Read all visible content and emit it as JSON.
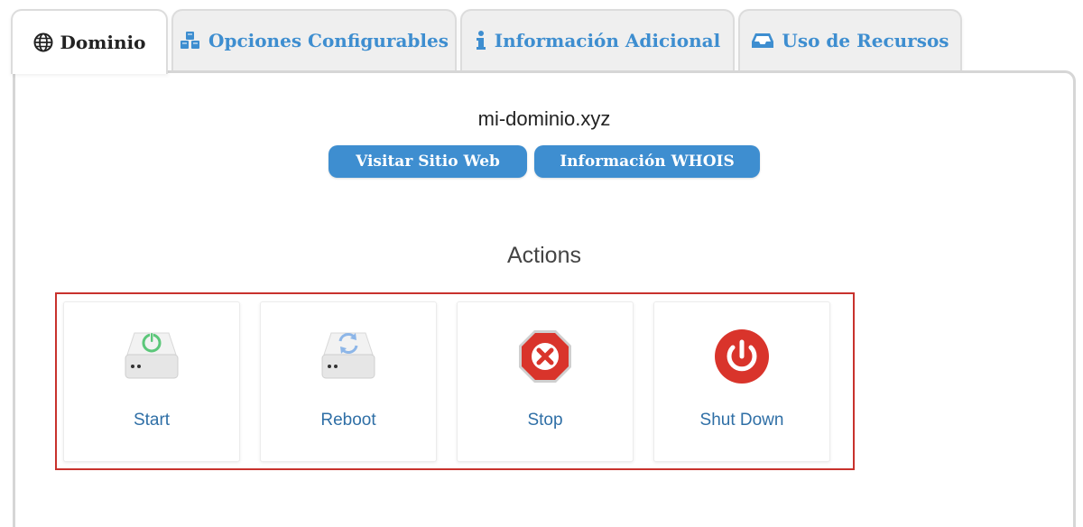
{
  "tabs": [
    {
      "label": "Dominio",
      "icon": "globe-icon",
      "active": true
    },
    {
      "label": "Opciones Configurables",
      "icon": "cubes-icon",
      "active": false
    },
    {
      "label": "Información Adicional",
      "icon": "info-icon",
      "active": false
    },
    {
      "label": "Uso de Recursos",
      "icon": "inbox-icon",
      "active": false
    }
  ],
  "domain": {
    "name": "mi-dominio.xyz",
    "visit_label": "Visitar Sitio Web",
    "whois_label": "Información WHOIS"
  },
  "actions": {
    "title": "Actions",
    "items": [
      {
        "label": "Start",
        "icon": "server-power-icon"
      },
      {
        "label": "Reboot",
        "icon": "server-reboot-icon"
      },
      {
        "label": "Stop",
        "icon": "stop-octagon-icon"
      },
      {
        "label": "Shut Down",
        "icon": "power-off-icon"
      }
    ]
  },
  "colors": {
    "accent": "#3e8ed0",
    "highlight_border": "#c8322d",
    "stop_red": "#d9342b",
    "start_green": "#5cc77a",
    "reboot_blue": "#8db6e8"
  }
}
